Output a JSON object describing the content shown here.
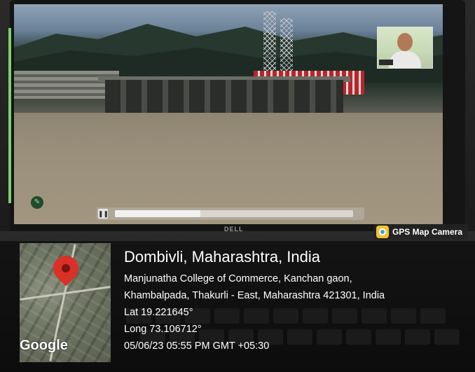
{
  "badge": {
    "label": "GPS Map Camera",
    "icon": "gps-map-camera-icon"
  },
  "screen": {
    "brand": "DELL",
    "video_progress": 0.36,
    "controls": {
      "pause_icon": "pause-icon",
      "pen_icon": "pen-icon"
    }
  },
  "map": {
    "logo_text": "Google",
    "pin_icon": "map-pin-icon"
  },
  "location": {
    "title": "Dombivli, Maharashtra, India",
    "address_line1": "Manjunatha College of Commerce, Kanchan gaon,",
    "address_line2": "Khambalpada, Thakurli - East, Maharashtra 421301, India",
    "lat": "Lat 19.221645°",
    "long": "Long 73.106712°",
    "datetime": "05/06/23 05:55 PM GMT +05:30"
  },
  "colors": {
    "pin": "#d93127",
    "overlay": "#000000",
    "badge_icon": "#f1c232"
  }
}
